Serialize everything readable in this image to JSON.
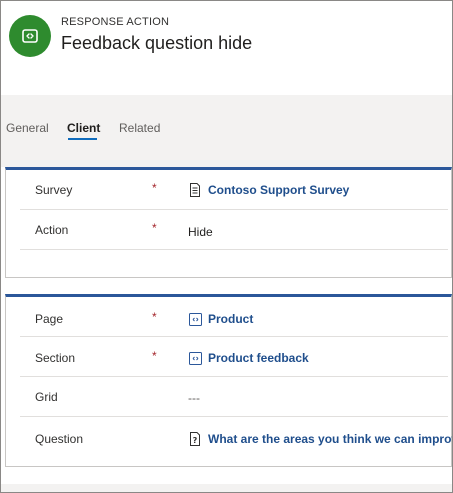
{
  "header": {
    "entity_type": "RESPONSE ACTION",
    "title": "Feedback question hide",
    "icon": "response-action-icon",
    "icon_color": "#2e8b2e"
  },
  "tabs": [
    {
      "label": "General",
      "active": false
    },
    {
      "label": "Client",
      "active": true
    },
    {
      "label": "Related",
      "active": false
    }
  ],
  "section1": {
    "fields": [
      {
        "label": "Survey",
        "required": "*",
        "value": "Contoso Support Survey",
        "icon": "survey-document-icon",
        "is_link": true
      },
      {
        "label": "Action",
        "required": "*",
        "value": "Hide",
        "is_link": false
      }
    ]
  },
  "section2": {
    "fields": [
      {
        "label": "Page",
        "required": "*",
        "value": "Product",
        "icon": "page-icon",
        "is_link": true
      },
      {
        "label": "Section",
        "required": "*",
        "value": "Product feedback",
        "icon": "section-icon",
        "is_link": true
      },
      {
        "label": "Grid",
        "required": "",
        "value": "---",
        "is_link": false
      },
      {
        "label": "Question",
        "required": "",
        "value": "What are the areas you think we can improve?",
        "icon": "question-icon",
        "is_link": true
      }
    ]
  },
  "colors": {
    "accent": "#2b579a",
    "link": "#1f4e8c",
    "required": "#a4262c",
    "tab_underline": "#0f6cbd"
  }
}
